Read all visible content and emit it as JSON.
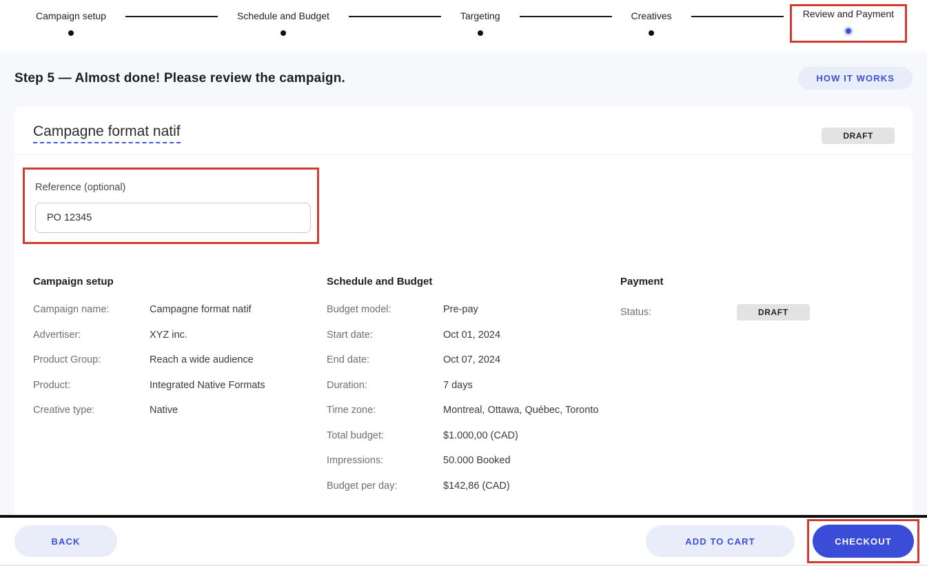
{
  "stepper": {
    "steps": [
      {
        "label": "Campaign setup",
        "state": "completed"
      },
      {
        "label": "Schedule and Budget",
        "state": "completed"
      },
      {
        "label": "Targeting",
        "state": "completed"
      },
      {
        "label": "Creatives",
        "state": "completed"
      },
      {
        "label": "Review and Payment",
        "state": "active",
        "highlighted": true
      }
    ]
  },
  "header": {
    "title": "Step 5 — Almost done! Please review the campaign.",
    "how_it_works_label": "HOW IT WORKS"
  },
  "card": {
    "title": "Campagne format natif",
    "status_badge": "DRAFT",
    "reference": {
      "label": "Reference (optional)",
      "value": "PO 12345"
    }
  },
  "sections": {
    "campaign_setup": {
      "title": "Campaign setup",
      "rows": [
        {
          "label": "Campaign name:",
          "value": "Campagne format natif"
        },
        {
          "label": "Advertiser:",
          "value": "XYZ inc."
        },
        {
          "label": "Product Group:",
          "value": "Reach a wide audience"
        },
        {
          "label": "Product:",
          "value": "Integrated Native Formats"
        },
        {
          "label": "Creative type:",
          "value": "Native"
        }
      ]
    },
    "schedule_budget": {
      "title": "Schedule and Budget",
      "rows": [
        {
          "label": "Budget model:",
          "value": "Pre-pay"
        },
        {
          "label": "Start date:",
          "value": "Oct 01, 2024"
        },
        {
          "label": "End date:",
          "value": "Oct 07, 2024"
        },
        {
          "label": "Duration:",
          "value": "7 days"
        },
        {
          "label": "Time zone:",
          "value": "Montreal, Ottawa, Québec, Toronto"
        },
        {
          "label": "Total budget:",
          "value": "$1.000,00 (CAD)"
        },
        {
          "label": "Impressions:",
          "value": "50.000 Booked"
        },
        {
          "label": "Budget per day:",
          "value": "$142,86 (CAD)"
        }
      ]
    },
    "payment": {
      "title": "Payment",
      "status_label": "Status:",
      "status_value": "DRAFT"
    }
  },
  "footer": {
    "back_label": "BACK",
    "add_to_cart_label": "ADD TO CART",
    "checkout_label": "CHECKOUT"
  },
  "colors": {
    "accent_blue": "#3b4fd8",
    "pill_background": "#e9ecf9",
    "annotation_red": "#d23b31",
    "badge_gray": "#e3e3e3",
    "page_background": "#f7f8fb"
  }
}
